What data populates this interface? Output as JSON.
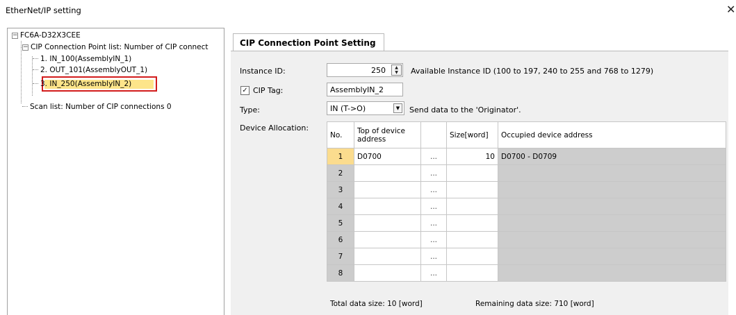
{
  "window": {
    "title": "EtherNet/IP setting",
    "close_glyph": "✕"
  },
  "tree": {
    "root": "FC6A-D32X3CEE",
    "cip_list": "CIP Connection Point list: Number of CIP connect",
    "items": [
      "1. IN_100(AssemblyIN_1)",
      "2. OUT_101(AssemblyOUT_1)",
      "3. IN_250(AssemblyIN_2)"
    ],
    "scan_list": "Scan list: Number of CIP connections 0",
    "selected_index": 2
  },
  "tab": {
    "label": "CIP Connection Point Setting"
  },
  "form": {
    "instance_id_label": "Instance ID:",
    "instance_id_value": "250",
    "instance_id_hint": "Available Instance ID (100 to 197, 240 to 255 and 768 to 1279)",
    "cip_tag_label": "CIP Tag:",
    "cip_tag_checked": true,
    "cip_tag_value": "AssemblyIN_2",
    "type_label": "Type:",
    "type_value": "IN (T->O)",
    "type_hint": "Send data to the 'Originator'.",
    "device_alloc_label": "Device Allocation:"
  },
  "table": {
    "headers": {
      "no": "No.",
      "top": "Top of device address",
      "size": "Size[word]",
      "occ": "Occupied device address"
    },
    "browse_label": "...",
    "rows": [
      {
        "no": "1",
        "top": "D0700",
        "size": "10",
        "occ": "D0700 - D0709"
      },
      {
        "no": "2",
        "top": "",
        "size": "",
        "occ": ""
      },
      {
        "no": "3",
        "top": "",
        "size": "",
        "occ": ""
      },
      {
        "no": "4",
        "top": "",
        "size": "",
        "occ": ""
      },
      {
        "no": "5",
        "top": "",
        "size": "",
        "occ": ""
      },
      {
        "no": "6",
        "top": "",
        "size": "",
        "occ": ""
      },
      {
        "no": "7",
        "top": "",
        "size": "",
        "occ": ""
      },
      {
        "no": "8",
        "top": "",
        "size": "",
        "occ": ""
      }
    ]
  },
  "footer": {
    "total": "Total data size: 10 [word]",
    "remaining": "Remaining data size: 710 [word]"
  },
  "colors": {
    "highlight_border": "#d21b1b",
    "selected_bg": "#fde58a",
    "active_row": "#fbdc8e"
  }
}
